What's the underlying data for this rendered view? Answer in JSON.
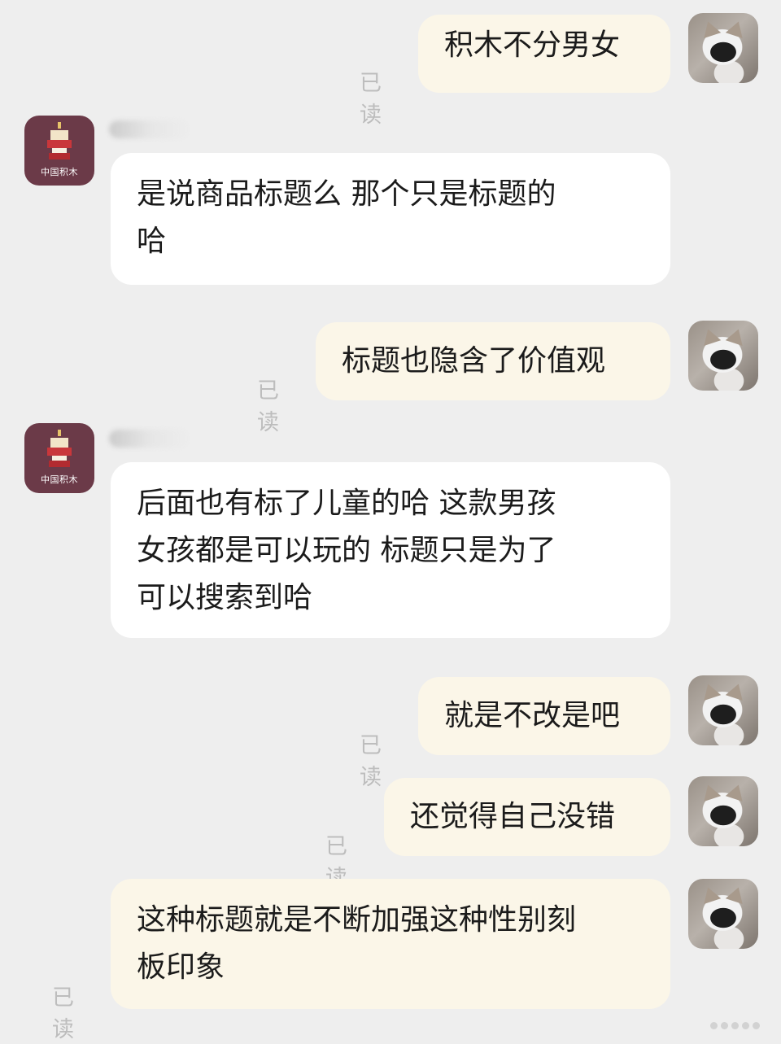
{
  "messages": [
    {
      "side": "outgoing",
      "text": "积木不分男女",
      "read": "已读"
    },
    {
      "side": "incoming",
      "avatar_label": "中国积木",
      "lines": [
        "是说商品标题么 那个只是标题的",
        "哈"
      ]
    },
    {
      "side": "outgoing",
      "text": "标题也隐含了价值观",
      "read": "已读"
    },
    {
      "side": "incoming",
      "avatar_label": "中国积木",
      "lines": [
        "后面也有标了儿童的哈 这款男孩",
        "女孩都是可以玩的 标题只是为了",
        "可以搜索到哈"
      ]
    },
    {
      "side": "outgoing",
      "text": "就是不改是吧",
      "read": "已读"
    },
    {
      "side": "outgoing",
      "text": "还觉得自己没错",
      "read": "已读"
    },
    {
      "side": "outgoing",
      "lines": [
        "这种标题就是不断加强这种性别刻",
        "板印象"
      ],
      "read": "已读"
    }
  ],
  "colors": {
    "background": "#eeeeee",
    "outgoing_bubble": "#fbf6e8",
    "incoming_bubble": "#ffffff",
    "read_text": "#bdbdbd",
    "shop_avatar": "#6b3a48"
  }
}
